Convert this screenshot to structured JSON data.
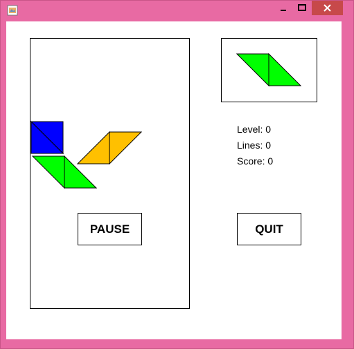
{
  "window": {
    "colors": {
      "frame": "#e86aa3",
      "close": "#c7494a"
    },
    "icons": [
      "app-icon",
      "minimize-icon",
      "maximize-icon",
      "close-icon"
    ]
  },
  "stats": {
    "level": "Level: 0",
    "lines": "Lines: 0",
    "score": "Score: 0"
  },
  "buttons": {
    "pause": "PAUSE",
    "quit": "QUIT"
  },
  "pieces": {
    "colors": {
      "blue": "#0000ff",
      "green": "#00ff00",
      "yellow": "#ffc000"
    }
  }
}
